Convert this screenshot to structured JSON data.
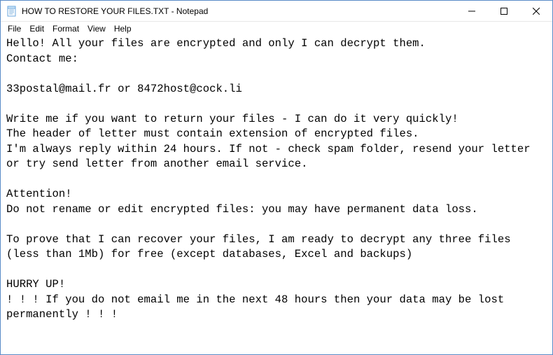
{
  "window": {
    "title": "HOW TO RESTORE YOUR FILES.TXT - Notepad"
  },
  "menubar": {
    "file": "File",
    "edit": "Edit",
    "format": "Format",
    "view": "View",
    "help": "Help"
  },
  "content": {
    "body": "Hello! All your files are encrypted and only I can decrypt them.\nContact me:\n\n33postal@mail.fr or 8472host@cock.li\n\nWrite me if you want to return your files - I can do it very quickly!\nThe header of letter must contain extension of encrypted files.\nI'm always reply within 24 hours. If not - check spam folder, resend your letter or try send letter from another email service.\n\nAttention!\nDo not rename or edit encrypted files: you may have permanent data loss.\n\nTo prove that I can recover your files, I am ready to decrypt any three files (less than 1Mb) for free (except databases, Excel and backups)\n\nHURRY UP!\n! ! ! If you do not email me in the next 48 hours then your data may be lost permanently ! ! !"
  }
}
